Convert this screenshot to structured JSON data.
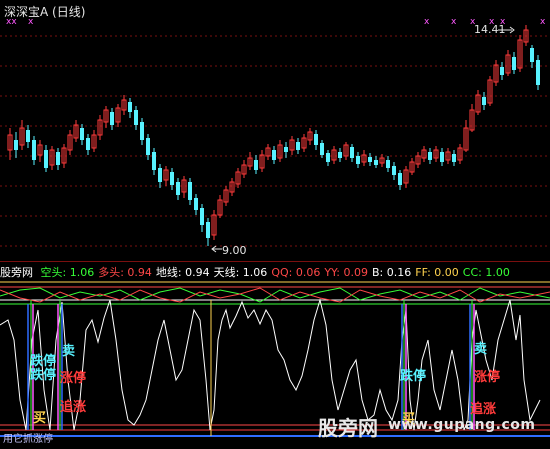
{
  "window": {
    "title": "深深宝A (日线)"
  },
  "price_panel": {
    "high_label": "14.41",
    "low_label": "9.00",
    "markers": "x"
  },
  "indicator_bar": {
    "name": "股旁网",
    "items": [
      {
        "label": "空头:",
        "value": "1.06",
        "color": "#37ff37"
      },
      {
        "label": "多头:",
        "value": "0.94",
        "color": "#ff4848"
      },
      {
        "label": "地线:",
        "value": "0.94",
        "color": "#ffffff"
      },
      {
        "label": "天线:",
        "value": "1.06",
        "color": "#ffffff"
      },
      {
        "label": "QQ:",
        "value": "0.06",
        "color": "#ff4848"
      },
      {
        "label": "YY:",
        "value": "0.09",
        "color": "#ff4848"
      },
      {
        "label": "B:",
        "value": "0.16",
        "color": "#ffffff"
      },
      {
        "label": "FF:",
        "value": "0.00",
        "color": "#ffd34f"
      },
      {
        "label": "CC:",
        "value": "1.00",
        "color": "#37ff37"
      }
    ]
  },
  "signals": {
    "zhang_ting": "涨停",
    "die_ting": "跌停",
    "zhui_zhang": "追涨",
    "mai": "买",
    "sell_hint": "卖"
  },
  "watermark": {
    "cn": "股旁网",
    "url": "www.gupang.com"
  },
  "footer": {
    "text": "用它抓涨停"
  },
  "colors": {
    "up": "#ff3b3b",
    "down": "#58f2ff",
    "grid": "#7a0f0f",
    "ind_white": "#ffffff"
  }
}
